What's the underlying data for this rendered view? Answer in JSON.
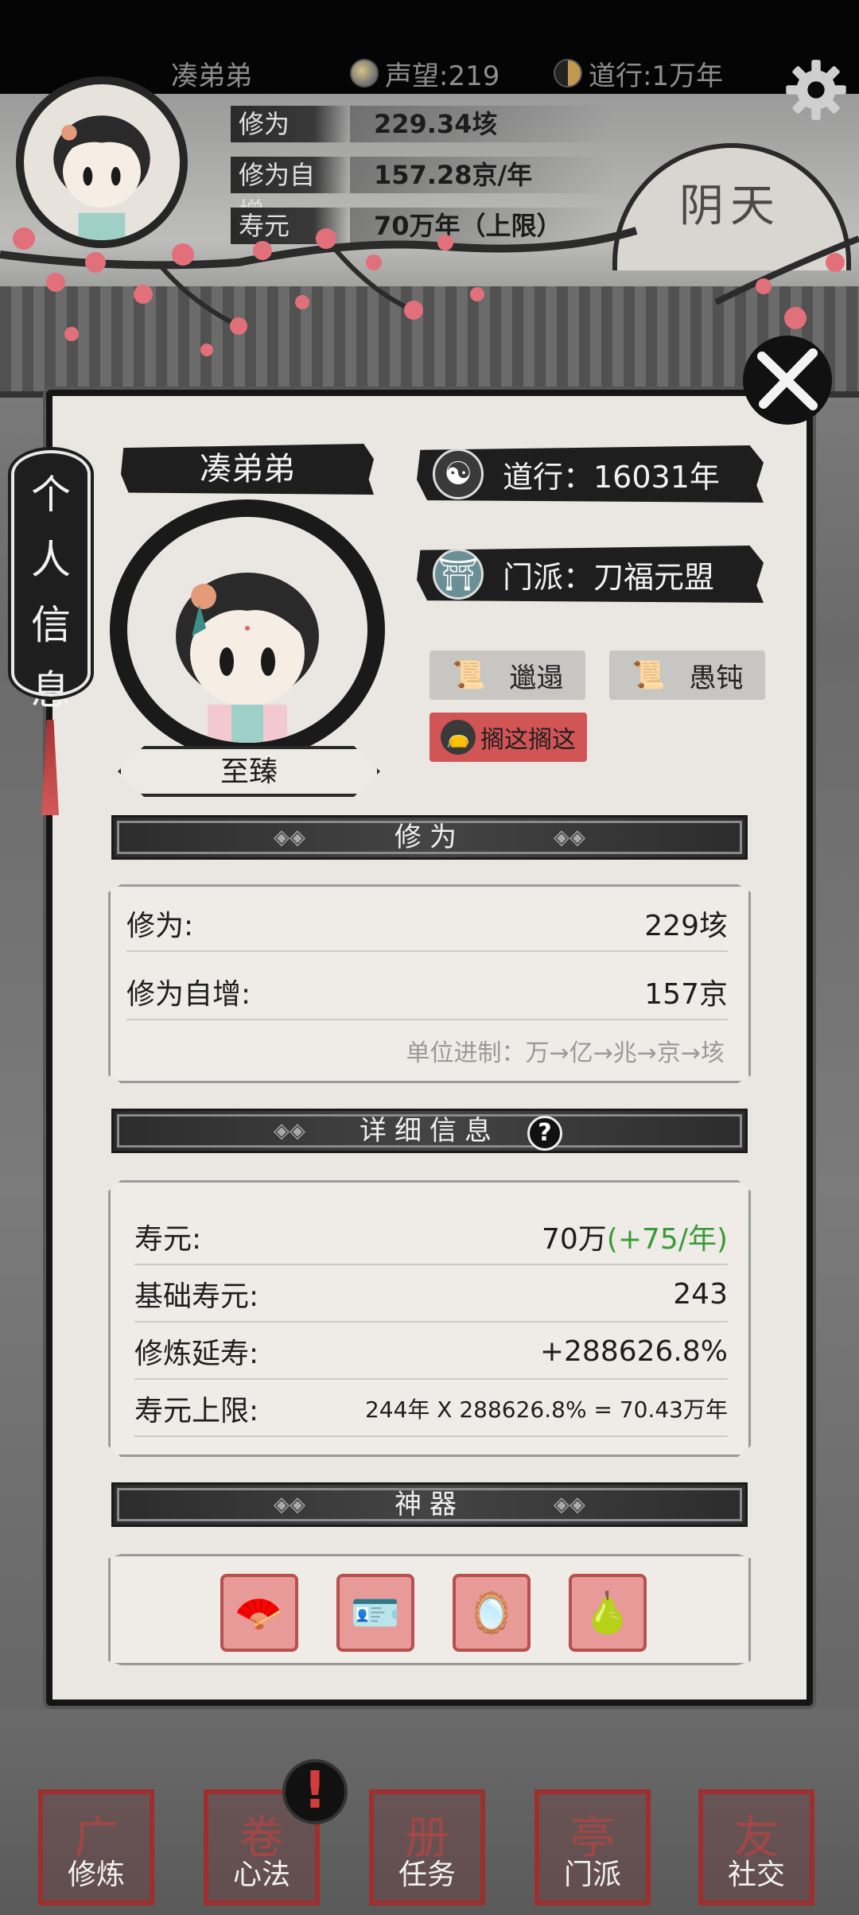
{
  "top": {
    "player_name": "凑弟弟",
    "reputation": "声望:219",
    "daoxing": "道行:1万年",
    "stats": [
      {
        "label": "修为",
        "value": "229.34垓"
      },
      {
        "label": "修为自增",
        "value": "157.28京/年"
      },
      {
        "label": "寿元",
        "value": "70万年（上限）"
      }
    ],
    "weather": "阴天"
  },
  "panel": {
    "side_tab": [
      "个",
      "人",
      "信",
      "息"
    ],
    "name": "凑弟弟",
    "title": "至臻",
    "daoxing": "道行：16031年",
    "sect": "门派：刀福元盟",
    "traits": [
      "邋遢",
      "愚钝",
      "搁这搁这"
    ],
    "cultivation_header": "修为",
    "cultivation_rows": [
      {
        "label": "修为:",
        "value": "229垓"
      },
      {
        "label": "修为自增:",
        "value": "157京"
      }
    ],
    "unit_note": "单位进制：万→亿→兆→京→垓",
    "details_header": "详细信息",
    "help": "?",
    "details_rows": [
      {
        "label": "寿元:",
        "value": "70万",
        "extra": "(+75/年)"
      },
      {
        "label": "基础寿元:",
        "value": "243"
      },
      {
        "label": "修炼延寿:",
        "value": "+288626.8%"
      },
      {
        "label": "寿元上限:",
        "value": "244年 X 288626.8% = 70.43万年"
      }
    ],
    "artifacts_header": "神器",
    "artifacts": [
      {
        "icon": "fan-icon",
        "glyph": "🪭"
      },
      {
        "icon": "token-icon",
        "glyph": "🪪"
      },
      {
        "icon": "mirror-icon",
        "glyph": "🪞"
      },
      {
        "icon": "gourd-icon",
        "glyph": "🍐"
      }
    ]
  },
  "nav": [
    {
      "label": "修炼",
      "glyph": "广"
    },
    {
      "label": "心法",
      "glyph": "卷"
    },
    {
      "label": "任务",
      "glyph": "册"
    },
    {
      "label": "门派",
      "glyph": "亭"
    },
    {
      "label": "社交",
      "glyph": "友"
    }
  ],
  "alert": "!",
  "colors": {
    "accent_red": "#d25555",
    "green": "#3c9a3c",
    "ink": "#1e1e1e"
  }
}
